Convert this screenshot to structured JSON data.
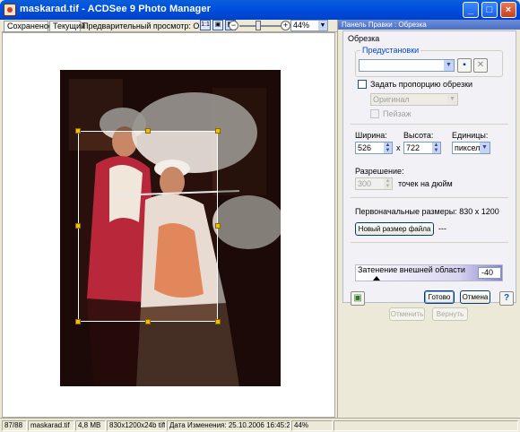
{
  "window": {
    "title": "maskarad.tif - ACDSee 9 Photo Manager"
  },
  "toolbar": {
    "tab_saved": "Сохраненое",
    "tab_current": "Текущий",
    "preview_label": "Предварительный просмотр: Об",
    "zoom_value": "44%"
  },
  "panel": {
    "title": "Панель Правки : Обрезка",
    "section_title": "Обрезка",
    "presets_legend": "Предустановки",
    "aspect_checkbox_label": "Задать пропорцию обрезки",
    "aspect_value": "Оригинал",
    "landscape_label": "Пейзаж",
    "width_label": "Ширина:",
    "height_label": "Высота:",
    "units_label": "Единицы:",
    "width_value": "526",
    "height_value": "722",
    "units_value": "пиксели",
    "times": "x",
    "resolution_label": "Разрешение:",
    "resolution_value": "300",
    "resolution_units": "точек на дюйм",
    "original_size": "Первоначальные размеры: 830 x 1200",
    "new_size_button": "Новый размер файла",
    "new_size_value": "---",
    "shade_label": "Затенение внешней области",
    "shade_value": "-40",
    "done_button": "Готово",
    "cancel_button": "Отмена",
    "undo_button": "Отменить",
    "redo_button": "Вернуть"
  },
  "status": {
    "index": "87/88",
    "filename": "maskarad.tif",
    "filesize": "4,8 MB",
    "dimensions": "830x1200x24b tiff",
    "modified": "Дата Изменения: 25.10.2006 16:45:25",
    "zoom": "44%"
  }
}
